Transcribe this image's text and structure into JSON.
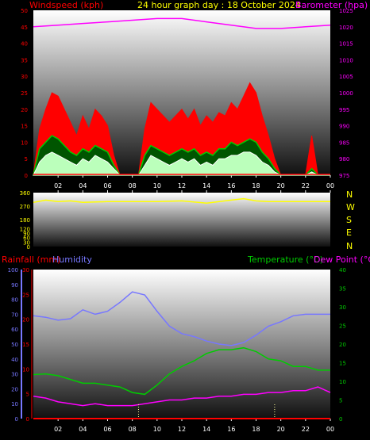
{
  "header": {
    "left_label": "Windspeed (kph)",
    "center_label": "24 hour graph day : 18 October 2024",
    "right_label": "Barometer (hpa)"
  },
  "direction_labels": [
    "N",
    "W",
    "S",
    "E",
    "N"
  ],
  "lower_labels": {
    "rainfall": "Rainfall (mm)",
    "humidity": "Humidity",
    "temperature": "Temperature (°C)",
    "dewpoint": "Dew Point (°C)"
  },
  "colors": {
    "wind": "#ff0000",
    "gust_green": "#00cc00",
    "avg_white": "#ffffff",
    "barometer": "#ff00ff",
    "direction": "#ffff00",
    "rainfall": "#ff0000",
    "humidity": "#7777ff",
    "temperature": "#00cc00",
    "dewpoint": "#ff00ff",
    "title": "#ffff00"
  },
  "chart_data": [
    {
      "type": "area",
      "title": "24 hour graph day : 18 October 2024",
      "x_ticks": [
        "02",
        "04",
        "06",
        "08",
        "10",
        "12",
        "14",
        "16",
        "18",
        "20",
        "22",
        "00"
      ],
      "y_left_label": "Windspeed (kph)",
      "y_left_ticks": [
        0,
        5,
        10,
        15,
        20,
        25,
        30,
        35,
        40,
        45,
        50
      ],
      "y_left_range": [
        0,
        50
      ],
      "y_right_label": "Barometer (hpa)",
      "y_right_ticks": [
        975,
        980,
        985,
        990,
        995,
        1000,
        1005,
        1010,
        1015,
        1020,
        1025
      ],
      "y_right_range": [
        975,
        1025
      ],
      "series": [
        {
          "name": "Windspeed (kph)",
          "x": [
            0,
            0.5,
            1,
            1.5,
            2,
            2.5,
            3,
            3.5,
            4,
            4.5,
            5,
            5.5,
            6,
            6.5,
            7,
            7.5,
            8,
            8.5,
            9,
            9.5,
            10,
            10.5,
            11,
            11.5,
            12,
            12.5,
            13,
            13.5,
            14,
            14.5,
            15,
            15.5,
            16,
            16.5,
            17,
            17.5,
            18,
            18.5,
            19,
            19.5,
            20,
            20.5,
            21,
            21.5,
            22,
            22.5,
            23,
            23.5,
            24
          ],
          "values": [
            0,
            14,
            20,
            25,
            24,
            20,
            16,
            12,
            18,
            14,
            20,
            18,
            15,
            6,
            0,
            0,
            0,
            0,
            14,
            22,
            20,
            18,
            16,
            18,
            20,
            17,
            20,
            15,
            18,
            16,
            19,
            18,
            22,
            20,
            24,
            28,
            25,
            18,
            12,
            5,
            0,
            0,
            0,
            0,
            0,
            12,
            0,
            0,
            0
          ]
        },
        {
          "name": "Gust (green)",
          "x": [
            0,
            0.5,
            1,
            1.5,
            2,
            2.5,
            3,
            3.5,
            4,
            4.5,
            5,
            5.5,
            6,
            6.5,
            7,
            7.5,
            8,
            8.5,
            9,
            9.5,
            10,
            10.5,
            11,
            11.5,
            12,
            12.5,
            13,
            13.5,
            14,
            14.5,
            15,
            15.5,
            16,
            16.5,
            17,
            17.5,
            18,
            18.5,
            19,
            19.5,
            20,
            20.5,
            21,
            21.5,
            22,
            22.5,
            23,
            23.5,
            24
          ],
          "values": [
            0,
            8,
            10,
            12,
            11,
            9,
            7,
            6,
            8,
            7,
            9,
            8,
            7,
            3,
            0,
            0,
            0,
            0,
            6,
            9,
            8,
            7,
            6,
            7,
            8,
            7,
            8,
            6,
            7,
            6,
            8,
            8,
            10,
            9,
            10,
            11,
            10,
            7,
            5,
            2,
            0,
            0,
            0,
            0,
            0,
            2,
            0,
            0,
            0
          ]
        },
        {
          "name": "Average (white)",
          "x": [
            0,
            0.5,
            1,
            1.5,
            2,
            2.5,
            3,
            3.5,
            4,
            4.5,
            5,
            5.5,
            6,
            6.5,
            7,
            7.5,
            8,
            8.5,
            9,
            9.5,
            10,
            10.5,
            11,
            11.5,
            12,
            12.5,
            13,
            13.5,
            14,
            14.5,
            15,
            15.5,
            16,
            16.5,
            17,
            17.5,
            18,
            18.5,
            19,
            19.5,
            20,
            20.5,
            21,
            21.5,
            22,
            22.5,
            23,
            23.5,
            24
          ],
          "values": [
            0,
            4,
            6,
            7,
            6,
            5,
            4,
            3,
            5,
            4,
            6,
            5,
            4,
            2,
            0,
            0,
            0,
            0,
            3,
            6,
            5,
            4,
            3,
            4,
            5,
            4,
            5,
            3,
            4,
            3,
            5,
            5,
            6,
            6,
            7,
            7,
            6,
            4,
            3,
            1,
            0,
            0,
            0,
            0,
            0,
            1,
            0,
            0,
            0
          ]
        },
        {
          "name": "Barometer (hpa)",
          "x": [
            0,
            2,
            4,
            6,
            8,
            10,
            12,
            14,
            16,
            18,
            20,
            22,
            24
          ],
          "values": [
            1020,
            1020.5,
            1021,
            1021.5,
            1022,
            1022.5,
            1022.5,
            1021.5,
            1020.5,
            1019.5,
            1019.5,
            1020,
            1020.5
          ]
        }
      ]
    },
    {
      "type": "line",
      "title": "",
      "x_ticks": [
        "02",
        "04",
        "06",
        "08",
        "10",
        "12",
        "14",
        "16",
        "18",
        "20",
        "22",
        "00"
      ],
      "y_ticks": [
        0,
        30,
        60,
        90,
        120,
        180,
        270,
        360
      ],
      "y_range": [
        0,
        360
      ],
      "series": [
        {
          "name": "Wind direction (deg)",
          "x": [
            0,
            1,
            2,
            3,
            4,
            6,
            8,
            10,
            12,
            14,
            16,
            17,
            18,
            19,
            20,
            22,
            24
          ],
          "values": [
            295,
            310,
            300,
            305,
            295,
            300,
            300,
            300,
            305,
            290,
            310,
            320,
            305,
            300,
            300,
            300,
            300
          ]
        }
      ]
    },
    {
      "type": "line",
      "title": "",
      "x_ticks": [
        "02",
        "04",
        "06",
        "08",
        "10",
        "12",
        "14",
        "16",
        "18",
        "20",
        "22",
        "00"
      ],
      "y_left_outer_ticks": [
        0,
        10,
        20,
        30,
        40,
        50,
        60,
        70,
        80,
        90,
        100
      ],
      "y_left_inner_ticks": [
        0,
        5,
        10,
        15,
        20,
        25,
        30
      ],
      "y_right_ticks": [
        0,
        5,
        10,
        15,
        20,
        25,
        30,
        35,
        40
      ],
      "series": [
        {
          "name": "Humidity",
          "x": [
            0,
            1,
            2,
            3,
            4,
            5,
            6,
            7,
            8,
            9,
            10,
            11,
            12,
            13,
            14,
            15,
            16,
            17,
            18,
            19,
            20,
            21,
            22,
            23,
            24
          ],
          "values": [
            69,
            68,
            66,
            67,
            73,
            70,
            72,
            78,
            85,
            83,
            72,
            62,
            57,
            55,
            52,
            50,
            49,
            51,
            56,
            62,
            65,
            69,
            70,
            70,
            70
          ]
        },
        {
          "name": "Temperature (°C)",
          "x": [
            0,
            1,
            2,
            3,
            4,
            5,
            6,
            7,
            8,
            9,
            10,
            11,
            12,
            13,
            14,
            15,
            16,
            17,
            18,
            19,
            20,
            21,
            22,
            23,
            24
          ],
          "values": [
            11.8,
            12,
            11.5,
            10.5,
            9.5,
            9.5,
            9,
            8.5,
            7,
            6.5,
            9,
            12,
            14,
            15.5,
            17.5,
            18.5,
            18.5,
            19,
            18,
            16,
            15.5,
            14,
            14,
            13,
            13
          ]
        },
        {
          "name": "Dew Point (°C)",
          "x": [
            0,
            1,
            2,
            3,
            4,
            5,
            6,
            7,
            8,
            9,
            10,
            11,
            12,
            13,
            14,
            15,
            16,
            17,
            18,
            19,
            20,
            21,
            22,
            23,
            24
          ],
          "values": [
            6,
            5.5,
            4.5,
            4,
            3.5,
            4,
            3.5,
            3.5,
            3.5,
            4,
            4.5,
            5,
            5,
            5.5,
            5.5,
            6,
            6,
            6.5,
            6.5,
            7,
            7,
            7.5,
            7.5,
            8.5,
            7
          ]
        },
        {
          "name": "Rainfall (mm)",
          "x": [
            0,
            24
          ],
          "values": [
            0,
            0
          ]
        }
      ]
    }
  ]
}
